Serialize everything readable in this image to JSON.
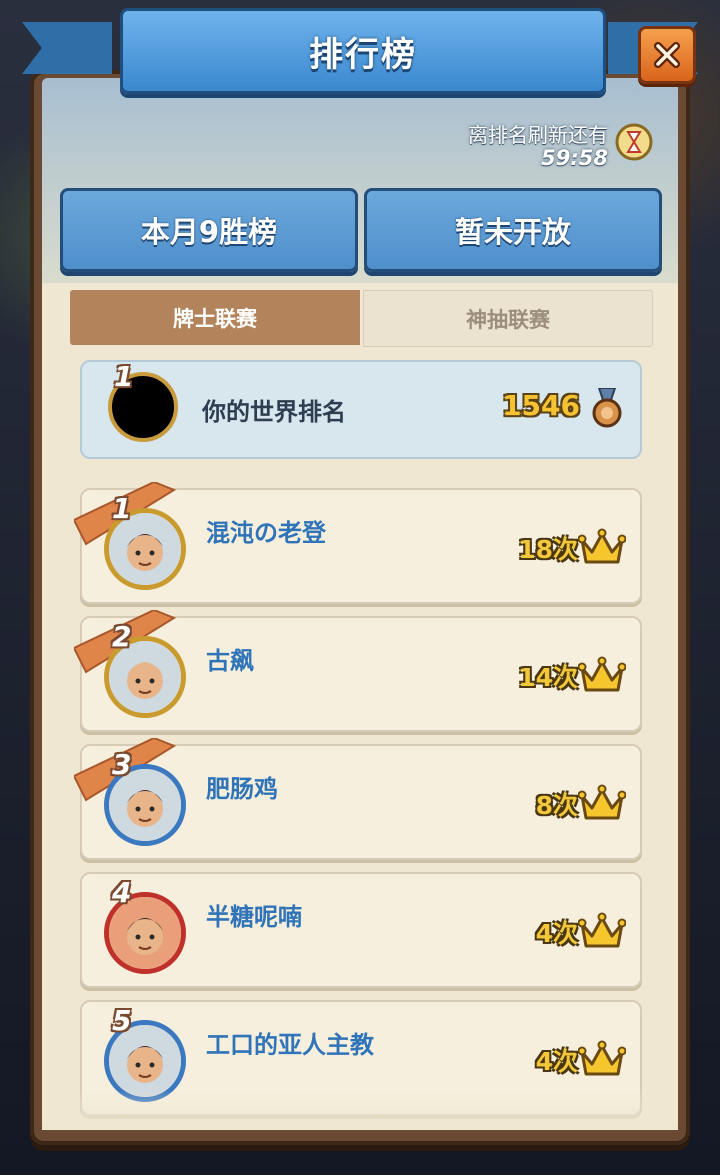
{
  "title": "排行榜",
  "refresh": {
    "label": "离排名刷新还有",
    "time": "59:58"
  },
  "categories": [
    "本月9胜榜",
    "暂未开放"
  ],
  "tabs": [
    {
      "label": "牌士联赛",
      "active": true
    },
    {
      "label": "神抽联赛",
      "active": false
    }
  ],
  "my_rank": {
    "rank": "1",
    "label": "你的世界排名",
    "score": "1546"
  },
  "rows": [
    {
      "rank": "1",
      "name": "混沌の老登",
      "count": "18次",
      "avatar": "bearded-hero-avatar",
      "frame_color": "#c99a2e"
    },
    {
      "rank": "2",
      "name": "古飙",
      "count": "14次",
      "avatar": "bald-brute-avatar",
      "frame_color": "#c99a2e"
    },
    {
      "rank": "3",
      "name": "肥肠鸡",
      "count": "8次",
      "avatar": "young-hero-avatar",
      "frame_color": "#3a78c0"
    },
    {
      "rank": "4",
      "name": "半糖呢喃",
      "count": "4次",
      "avatar": "red-hood-avatar",
      "frame_color": "#c0302a"
    },
    {
      "rank": "5",
      "name": "工口的亚人主教",
      "count": "4次",
      "avatar": "young-hero-avatar",
      "frame_color": "#3a78c0"
    }
  ],
  "colors": {
    "ribbon": "#3b88cf",
    "active_tab": "#b3845c",
    "name_blue": "#2f74b8",
    "gold": "#f2c73a",
    "banner_orange": "#e0854a"
  }
}
